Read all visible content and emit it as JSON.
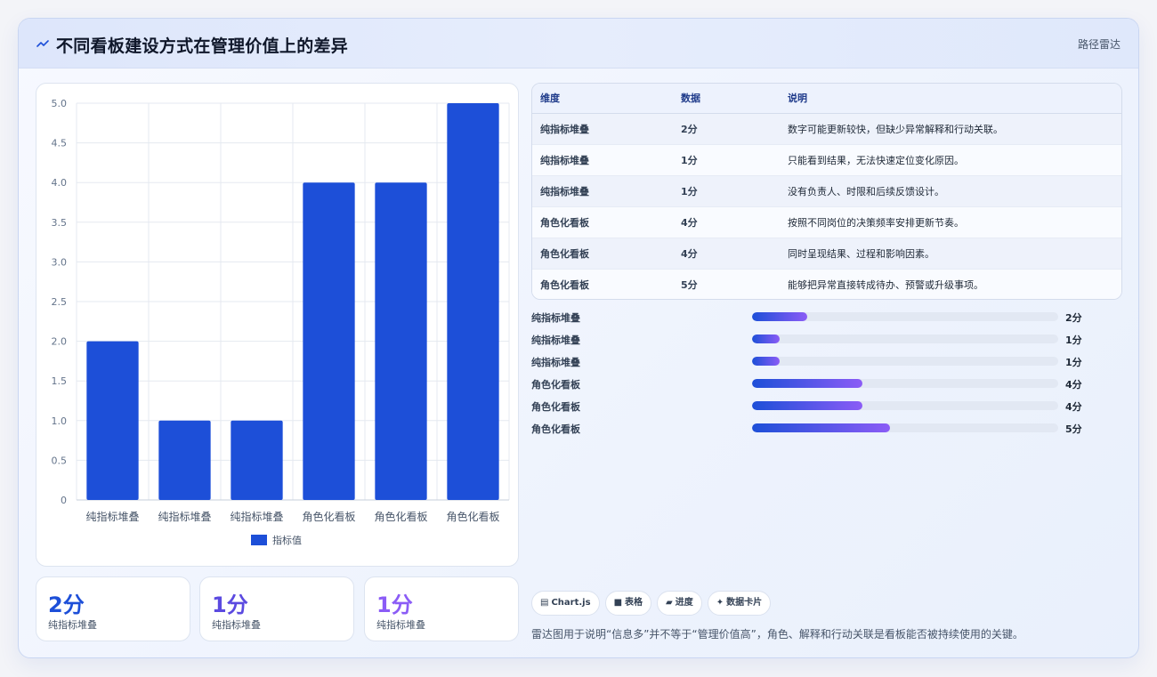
{
  "header": {
    "title": "不同看板建设方式在管理价值上的差异",
    "tag": "路径雷达",
    "logo_icon": "sparkline-icon"
  },
  "chart_data": {
    "type": "bar",
    "categories": [
      "纯指标堆叠",
      "纯指标堆叠",
      "纯指标堆叠",
      "角色化看板",
      "角色化看板",
      "角色化看板"
    ],
    "series": [
      {
        "name": "指标值",
        "values": [
          2,
          1,
          1,
          4,
          4,
          5
        ],
        "color": "#1d4fd8"
      }
    ],
    "ylim": [
      0,
      5
    ],
    "yticks": [
      "0",
      "0.5",
      "1.0",
      "1.5",
      "2.0",
      "2.5",
      "3.0",
      "3.5",
      "4.0",
      "4.5",
      "5.0"
    ],
    "grid": true,
    "legend": "bottom"
  },
  "stats": [
    {
      "value": "2分",
      "label": "纯指标堆叠",
      "color": "#1d4fd8"
    },
    {
      "value": "1分",
      "label": "纯指标堆叠",
      "color": "#5b4ae0"
    },
    {
      "value": "1分",
      "label": "纯指标堆叠",
      "color": "#8b5cf6"
    }
  ],
  "table": {
    "headers": [
      "维度",
      "数据",
      "说明"
    ],
    "rows": [
      [
        "纯指标堆叠",
        "2分",
        "数字可能更新较快，但缺少异常解释和行动关联。"
      ],
      [
        "纯指标堆叠",
        "1分",
        "只能看到结果，无法快速定位变化原因。"
      ],
      [
        "纯指标堆叠",
        "1分",
        "没有负责人、时限和后续反馈设计。"
      ],
      [
        "角色化看板",
        "4分",
        "按照不同岗位的决策频率安排更新节奏。"
      ],
      [
        "角色化看板",
        "4分",
        "同时呈现结果、过程和影响因素。"
      ],
      [
        "角色化看板",
        "5分",
        "能够把异常直接转成待办、预警或升级事项。"
      ]
    ]
  },
  "progress": [
    {
      "label": "纯指标堆叠",
      "value": "2分",
      "fraction": 0.18
    },
    {
      "label": "纯指标堆叠",
      "value": "1分",
      "fraction": 0.09
    },
    {
      "label": "纯指标堆叠",
      "value": "1分",
      "fraction": 0.09
    },
    {
      "label": "角色化看板",
      "value": "4分",
      "fraction": 0.36
    },
    {
      "label": "角色化看板",
      "value": "4分",
      "fraction": 0.36
    },
    {
      "label": "角色化看板",
      "value": "5分",
      "fraction": 0.45
    }
  ],
  "chips": [
    {
      "icon": "chart-icon",
      "glyph": "▤",
      "label": "Chart.js"
    },
    {
      "icon": "table-icon",
      "glyph": "■",
      "label": "表格"
    },
    {
      "icon": "progress-icon",
      "glyph": "▰",
      "label": "进度"
    },
    {
      "icon": "card-icon",
      "glyph": "✦",
      "label": "数据卡片"
    }
  ],
  "note": "雷达图用于说明“信息多”并不等于“管理价值高”，角色、解释和行动关联是看板能否被持续使用的关键。"
}
